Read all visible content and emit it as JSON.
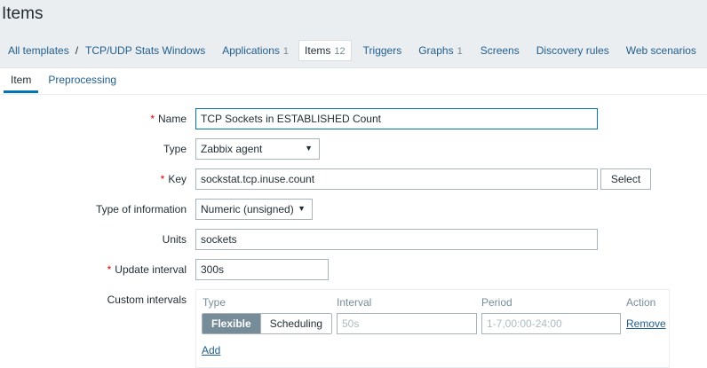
{
  "page": {
    "title": "Items"
  },
  "breadcrumbs": {
    "all_templates": "All templates",
    "template": "TCP/UDP Stats Windows",
    "applications": {
      "label": "Applications",
      "count": "1"
    },
    "items": {
      "label": "Items",
      "count": "12"
    },
    "triggers": "Triggers",
    "graphs": {
      "label": "Graphs",
      "count": "1"
    },
    "screens": "Screens",
    "discovery_rules": "Discovery rules",
    "web_scenarios": "Web scenarios"
  },
  "tabs": {
    "item": "Item",
    "preprocessing": "Preprocessing"
  },
  "form": {
    "name": {
      "label": "Name",
      "required_mark": "*",
      "value": "TCP Sockets in ESTABLISHED Count"
    },
    "type": {
      "label": "Type",
      "value": "Zabbix agent"
    },
    "key": {
      "label": "Key",
      "required_mark": "*",
      "value": "sockstat.tcp.inuse.count",
      "select_button": "Select"
    },
    "type_of_information": {
      "label": "Type of information",
      "value": "Numeric (unsigned)"
    },
    "units": {
      "label": "Units",
      "value": "sockets"
    },
    "update_interval": {
      "label": "Update interval",
      "required_mark": "*",
      "value": "300s"
    },
    "custom_intervals": {
      "label": "Custom intervals",
      "headers": {
        "type": "Type",
        "interval": "Interval",
        "period": "Period",
        "action": "Action"
      },
      "row": {
        "flexible": "Flexible",
        "scheduling": "Scheduling",
        "interval_placeholder": "50s",
        "period_placeholder": "1-7,00:00-24:00",
        "remove": "Remove"
      },
      "add": "Add"
    }
  },
  "colors": {
    "link": "#1f5e8f",
    "active_tab_border": "#0274b8",
    "required": "#d40000",
    "segment_on": "#768d99"
  },
  "icons": {
    "dropdown": "triangle-down-icon"
  }
}
